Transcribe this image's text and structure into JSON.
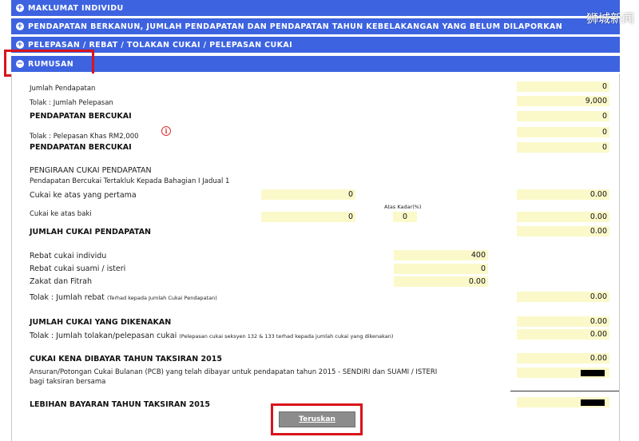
{
  "sections": {
    "individual": "MAKLUMAT INDIVIDU",
    "arrears": "PENDAPATAN BERKANUN, JUMLAH PENDAPATAN DAN PENDAPATAN TAHUN KEBELAKANGAN YANG BELUM DILAPORKAN",
    "reliefs": "PELEPASAN / REBAT / TOLAKAN CUKAI / PELEPASAN CUKAI",
    "summary": "RUMUSAN"
  },
  "watermark": "狮城新闻",
  "form": {
    "jumlah_pendapatan": {
      "label": "Jumlah Pendapatan",
      "value": "0"
    },
    "tolak_pelepasan": {
      "label": "Tolak : Jumlah Pelepasan",
      "value": "9,000"
    },
    "pendapatan_bercukai_1": {
      "label": "PENDAPATAN BERCUKAI",
      "value": "0"
    },
    "pelepasan_khas": {
      "label": "Tolak : Pelepasan Khas RM2,000",
      "value": "0"
    },
    "pendapatan_bercukai_2": {
      "label": "PENDAPATAN BERCUKAI",
      "value": "0"
    },
    "pengiraan_title": "PENGIRAAN CUKAI PENDAPATAN",
    "pengiraan_sub": "Pendapatan Bercukai Tertakluk Kepada Bahagian I Jadual 1",
    "cukai_pertama": {
      "label": "Cukai ke atas yang pertama",
      "mid": "0",
      "value": "0.00"
    },
    "atas_kadar_label": "Atas Kadar(%)",
    "cukai_baki": {
      "label": "Cukai ke atas baki",
      "mid": "0",
      "rate": "0",
      "value": "0.00"
    },
    "jumlah_cukai_pendapatan": {
      "label": "JUMLAH CUKAI PENDAPATAN",
      "value": "0.00"
    },
    "rebat_individu": {
      "label": "Rebat cukai individu",
      "value": "400"
    },
    "rebat_suami": {
      "label": "Rebat cukai suami / isteri",
      "value": "0"
    },
    "zakat": {
      "label": "Zakat dan Fitrah",
      "value": "0.00"
    },
    "jumlah_rebat": {
      "label": "Tolak : Jumlah rebat",
      "note": "(Terhad kepada Jumlah Cukai Pendapatan)",
      "value": "0.00"
    },
    "jumlah_dikenakan": {
      "label": "JUMLAH CUKAI YANG DIKENAKAN",
      "value": "0.00"
    },
    "jumlah_tolakan": {
      "label": "Tolak : Jumlah tolakan/pelepasan cukai",
      "note": "(Pelepasan cukai seksyen 132 & 133 terhad kepada jumlah cukai yang dikenakan)",
      "value": "0.00"
    },
    "cukai_kena_dibayar": {
      "label": "CUKAI KENA DIBAYAR TAHUN TAKSIRAN 2015",
      "value": "0.00"
    },
    "ansuran_line1": "Ansuran/Potongan Cukai Bulanan (PCB) yang telah dibayar untuk pendapatan tahun 2015 - SENDIRI dan SUAMI / ISTERI",
    "ansuran_line2": "bagi taksiran bersama",
    "lebihan_bayaran": "LEBIHAN BAYARAN TAHUN TAKSIRAN 2015"
  },
  "button": {
    "next": "Teruskan"
  },
  "colors": {
    "section_bar": "#3d63e0",
    "field_bg": "#fbf9c9",
    "highlight": "#d8141a",
    "button": "#8c8c8c"
  }
}
